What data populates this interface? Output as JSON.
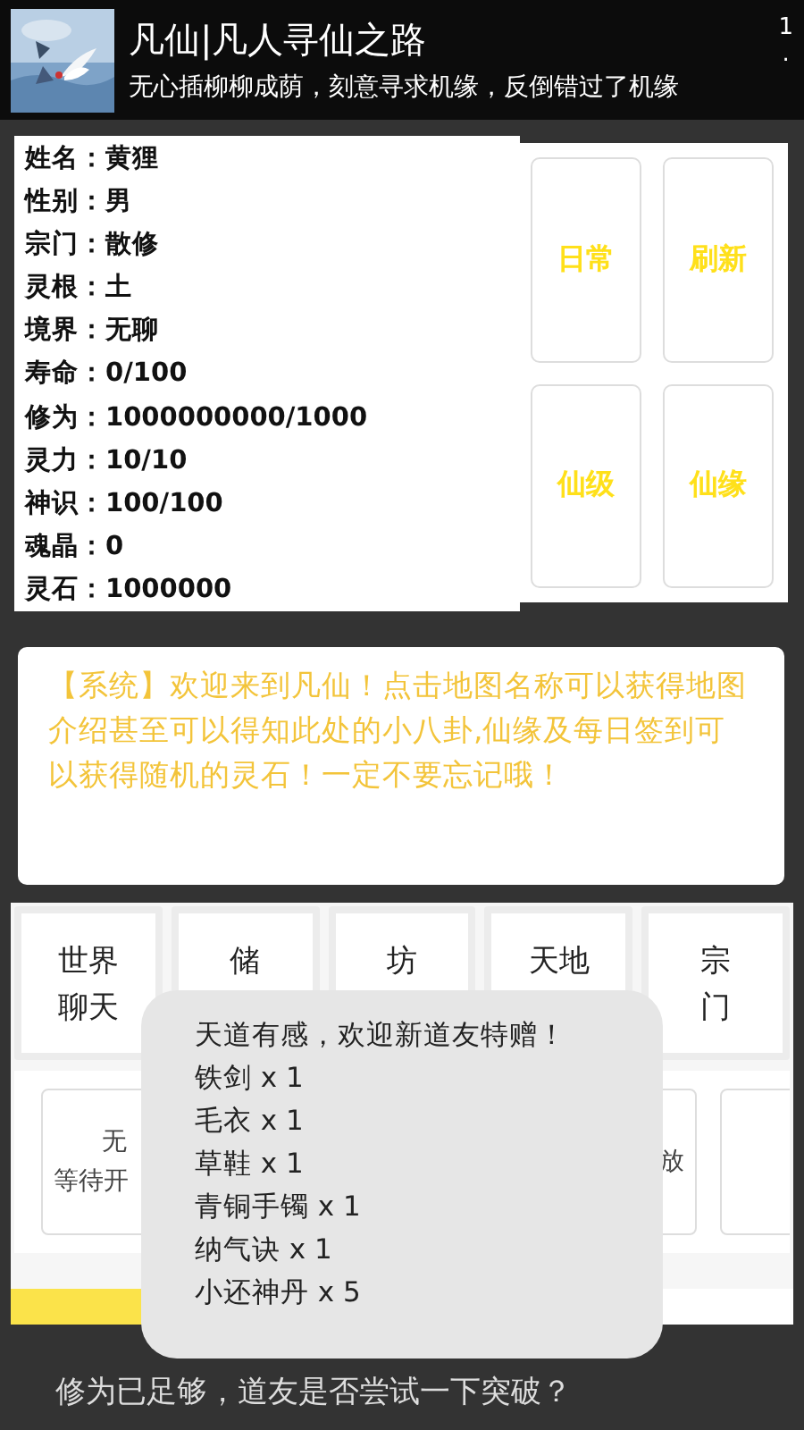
{
  "header": {
    "kind": "picture",
    "title": "凡仙|凡人寻仙之路",
    "subtitle": "无心插柳柳成荫，刻意寻求机缘，反倒错过了机缘",
    "corner": [
      "1",
      "."
    ]
  },
  "stats": [
    {
      "label": "姓名：",
      "value": "黄狸"
    },
    {
      "label": "性别：",
      "value": "男"
    },
    {
      "label": "宗门：",
      "value": "散修"
    },
    {
      "label": "灵根：",
      "value": "土"
    },
    {
      "label": "境界：",
      "value": "无聊"
    },
    {
      "label": "寿命：",
      "value": "0/100"
    },
    {
      "label": "修为：",
      "value": "1000000000/1000"
    },
    {
      "label": "灵力：",
      "value": "10/10"
    },
    {
      "label": "神识：",
      "value": "100/100"
    },
    {
      "label": "魂晶：",
      "value": "0"
    },
    {
      "label": "灵石：",
      "value": "1000000"
    }
  ],
  "actions": [
    "日常",
    "刷新",
    "仙级",
    "仙缘"
  ],
  "system_message": "【系统】欢迎来到凡仙！点击地图名称可以获得地图介绍甚至可以得知此处的小八卦,仙缘及每日签到可以获得随机的灵石！一定不要忘记哦！",
  "functions": [
    {
      "lines": [
        "世界",
        "聊天"
      ]
    },
    {
      "lines": [
        "储"
      ]
    },
    {
      "lines": [
        "坊"
      ]
    },
    {
      "lines": [
        "天地"
      ]
    },
    {
      "lines": [
        "宗",
        "门"
      ]
    }
  ],
  "slots": [
    {
      "kind": "head",
      "title": "无",
      "status": "等待开"
    },
    {
      "kind": "tail",
      "status": "放"
    },
    {
      "kind": "empty"
    }
  ],
  "progress": {
    "level": 0.32
  },
  "prompt": "修为已足够，道友是否尝试一下突破？",
  "toast": {
    "title": "天道有感，欢迎新道友特赠！",
    "items": [
      "铁剑 x 1",
      "毛衣 x 1",
      "草鞋 x 1",
      "青铜手镯 x 1",
      "纳气诀 x 1",
      "小还神丹 x 5"
    ]
  }
}
